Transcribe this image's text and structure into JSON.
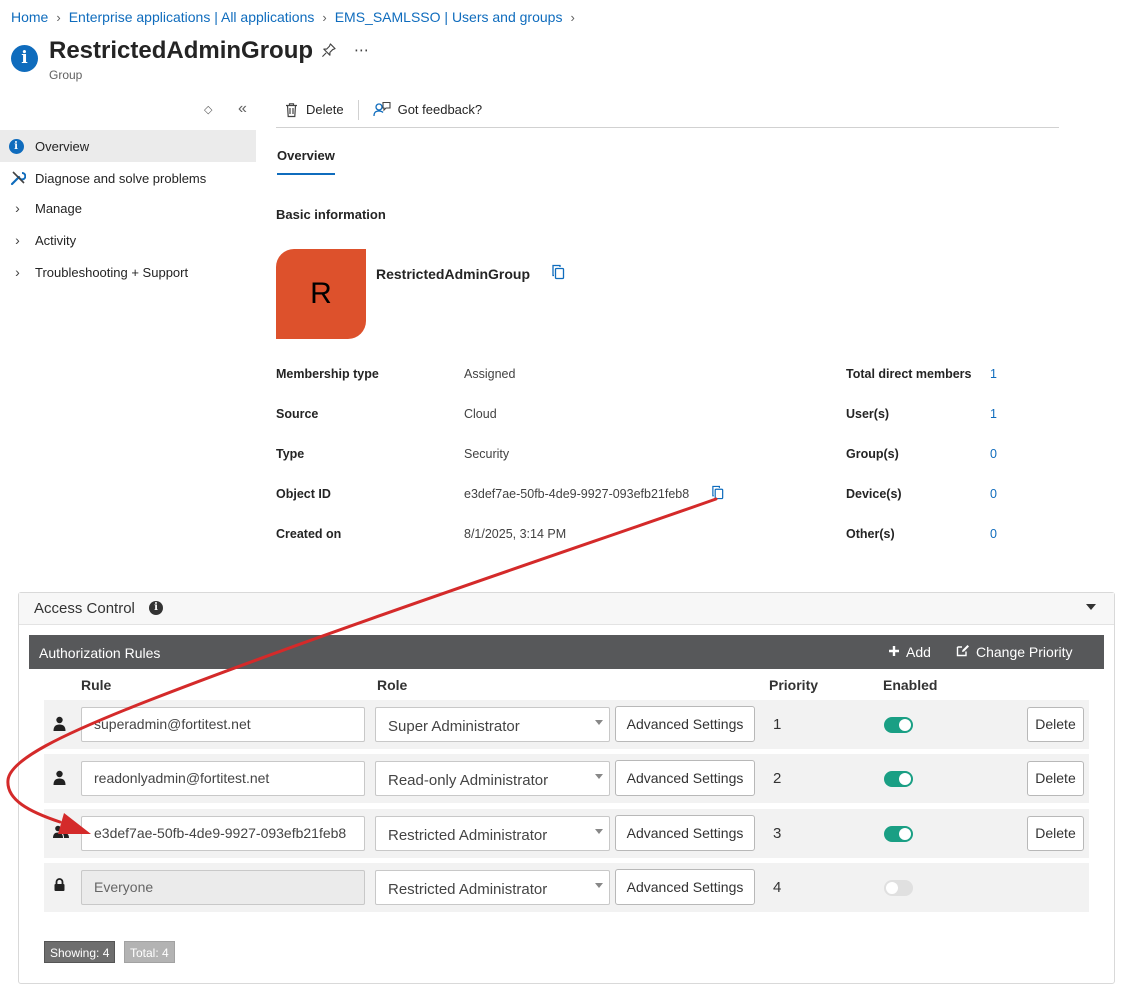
{
  "breadcrumb": [
    {
      "label": "Home"
    },
    {
      "label": "Enterprise applications | All applications"
    },
    {
      "label": "EMS_SAMLSSO | Users and groups"
    }
  ],
  "header": {
    "title": "RestrictedAdminGroup",
    "subtitle": "Group",
    "icon": "info-icon"
  },
  "sidebar": {
    "items": [
      {
        "label": "Overview",
        "icon": "info-icon",
        "active": true
      },
      {
        "label": "Diagnose and solve problems",
        "icon": "wrench-icon"
      },
      {
        "label": "Manage",
        "icon": "chevron-right-icon"
      },
      {
        "label": "Activity",
        "icon": "chevron-right-icon"
      },
      {
        "label": "Troubleshooting + Support",
        "icon": "chevron-right-icon"
      }
    ]
  },
  "commandbar": {
    "delete_label": "Delete",
    "feedback_label": "Got feedback?"
  },
  "tabs": {
    "overview": "Overview"
  },
  "basic": {
    "title": "Basic information",
    "avatar_letter": "R",
    "group_name": "RestrictedAdminGroup",
    "avatar_color": "#dd512c",
    "props": [
      {
        "label": "Membership type",
        "value": "Assigned"
      },
      {
        "label": "Source",
        "value": "Cloud"
      },
      {
        "label": "Type",
        "value": "Security"
      },
      {
        "label": "Object ID",
        "value": "e3def7ae-50fb-4de9-9927-093efb21feb8"
      },
      {
        "label": "Created on",
        "value": "8/1/2025, 3:14 PM"
      }
    ],
    "counts": [
      {
        "label": "Total direct members",
        "value": "1"
      },
      {
        "label": "User(s)",
        "value": "1"
      },
      {
        "label": "Group(s)",
        "value": "0"
      },
      {
        "label": "Device(s)",
        "value": "0"
      },
      {
        "label": "Other(s)",
        "value": "0"
      }
    ]
  },
  "access_control": {
    "title": "Access Control",
    "auth_title": "Authorization Rules",
    "add_label": "Add",
    "change_priority_label": "Change Priority",
    "columns": {
      "rule": "Rule",
      "role": "Role",
      "priority": "Priority",
      "enabled": "Enabled"
    },
    "rows": [
      {
        "icon": "user-icon",
        "rule": "superadmin@fortitest.net",
        "role": "Super Administrator",
        "advanced": "Advanced Settings",
        "priority": "1",
        "enabled": true,
        "delete": "Delete"
      },
      {
        "icon": "user-icon",
        "rule": "readonlyadmin@fortitest.net",
        "role": "Read-only Administrator",
        "advanced": "Advanced Settings",
        "priority": "2",
        "enabled": true,
        "delete": "Delete"
      },
      {
        "icon": "users-icon",
        "rule": "e3def7ae-50fb-4de9-9927-093efb21feb8",
        "role": "Restricted Administrator",
        "advanced": "Advanced Settings",
        "priority": "3",
        "enabled": true,
        "delete": "Delete"
      },
      {
        "icon": "lock-icon",
        "rule": "Everyone",
        "role": "Restricted Administrator",
        "advanced": "Advanced Settings",
        "priority": "4",
        "enabled": false
      }
    ],
    "showing": "Showing: 4",
    "total": "Total: 4",
    "toggle_on_color": "#1a9f84",
    "header_bg": "#57585a"
  },
  "annotation": {
    "arrow_color": "#d42a2a"
  }
}
